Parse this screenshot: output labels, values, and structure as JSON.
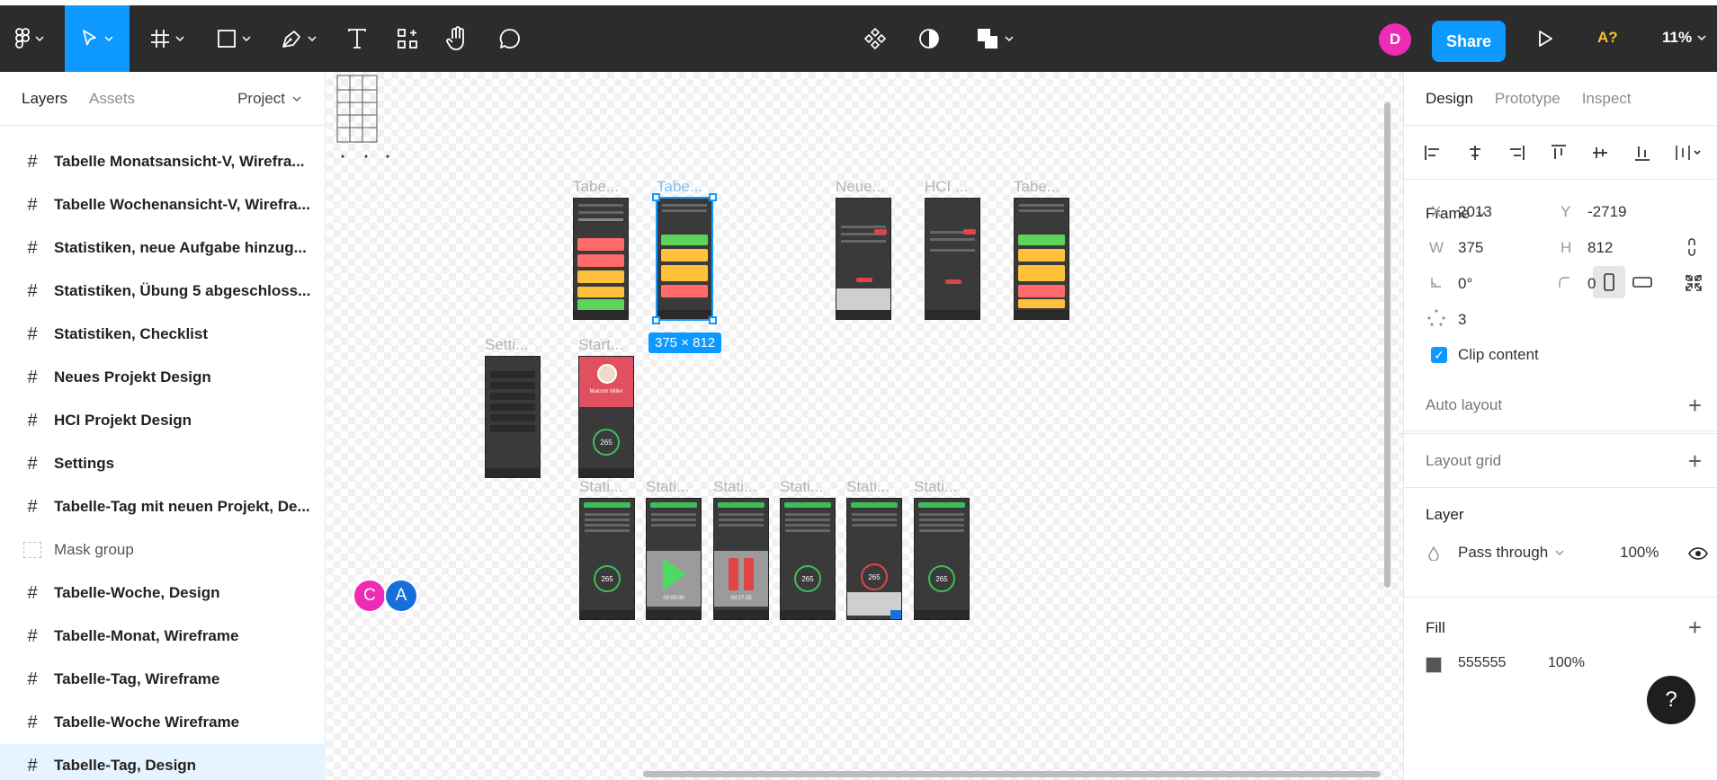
{
  "toolbar": {
    "share_label": "Share",
    "user_initial": "D",
    "accessibility_label": "A?",
    "zoom_label": "11%"
  },
  "left_panel": {
    "tabs": [
      "Layers",
      "Assets"
    ],
    "page_selector": "Project",
    "layers": [
      {
        "name": "Tabelle Monatsansicht-V, Wirefra...",
        "type": "frame"
      },
      {
        "name": "Tabelle Wochenansicht-V, Wirefra...",
        "type": "frame"
      },
      {
        "name": "Statistiken, neue Aufgabe hinzug...",
        "type": "frame"
      },
      {
        "name": "Statistiken, Übung 5 abgeschloss...",
        "type": "frame"
      },
      {
        "name": "Statistiken, Checklist",
        "type": "frame"
      },
      {
        "name": "Neues Projekt Design",
        "type": "frame"
      },
      {
        "name": "HCI Projekt Design",
        "type": "frame"
      },
      {
        "name": "Settings",
        "type": "frame"
      },
      {
        "name": "Tabelle-Tag mit neuen Projekt, De...",
        "type": "frame"
      },
      {
        "name": "Mask group",
        "type": "mask"
      },
      {
        "name": "Tabelle-Woche, Design",
        "type": "frame"
      },
      {
        "name": "Tabelle-Monat, Wireframe",
        "type": "frame"
      },
      {
        "name": "Tabelle-Tag, Wireframe",
        "type": "frame"
      },
      {
        "name": "Tabelle-Woche Wireframe",
        "type": "frame"
      },
      {
        "name": "Tabelle-Tag, Design",
        "type": "frame"
      }
    ]
  },
  "canvas": {
    "frame_labels": {
      "f1": "Tabe...",
      "f2": "Tabe...",
      "f3": "Neue...",
      "f4": "HCI ...",
      "f5": "Tabe...",
      "f6": "Setti...",
      "f7": "Start...",
      "s1": "Stati...",
      "s2": "Stati...",
      "s3": "Stati...",
      "s4": "Stati...",
      "s5": "Stati...",
      "s6": "Stati..."
    },
    "selection_size": "375 × 812",
    "collaborators": [
      "C",
      "A"
    ],
    "profile_name": "Malcom Miller",
    "stat_value": "265",
    "timer_1": "00:00:00",
    "timer_2": "00:27:35"
  },
  "right_panel": {
    "tabs": [
      "Design",
      "Prototype",
      "Inspect"
    ],
    "frame_section_title": "Frame",
    "x_label": "X",
    "x_value": "2013",
    "y_label": "Y",
    "y_value": "-2719",
    "w_label": "W",
    "w_value": "375",
    "h_label": "H",
    "h_value": "812",
    "rotation_value": "0°",
    "radius_value": "0",
    "points_value": "3",
    "clip_content_label": "Clip content",
    "auto_layout_title": "Auto layout",
    "layout_grid_title": "Layout grid",
    "layer_title": "Layer",
    "blend_mode": "Pass through",
    "layer_opacity": "100%",
    "fill_title": "Fill",
    "fill_hex": "555555",
    "fill_opacity": "100%"
  },
  "colors": {
    "accent": "#0d99ff",
    "toolbar_bg": "#2c2c2c",
    "avatar_pink": "#ee2bb5",
    "avatar_blue": "#1470d8",
    "accessibility_yellow": "#f7c02c"
  }
}
